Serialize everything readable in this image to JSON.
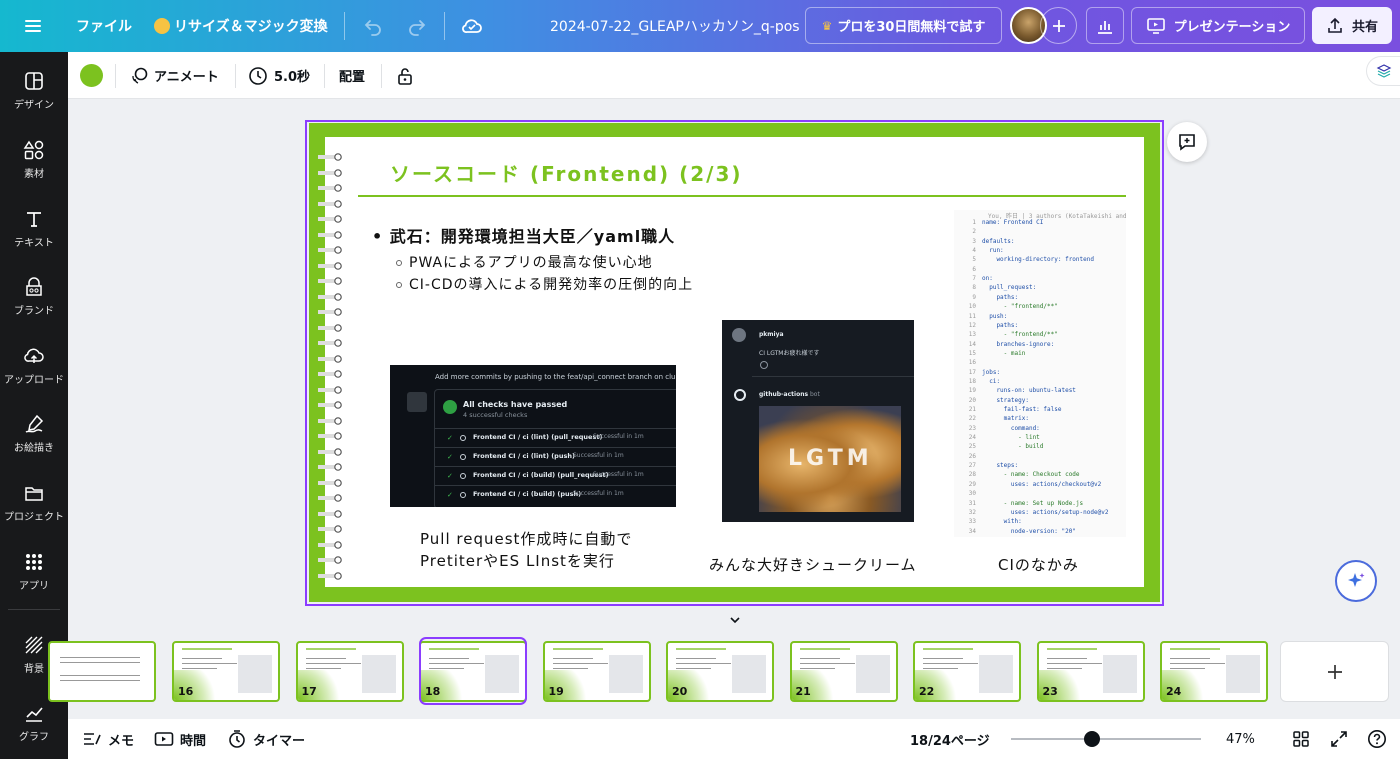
{
  "topbar": {
    "menu_icon": "hamburger-icon",
    "file_label": "ファイル",
    "resize_label": "リサイズ＆マジック変換",
    "doc_title": "2024-07-22_GLEAPハッカソン_q-pos",
    "pro_label": "プロを30日間無料で試す",
    "present_label": "プレゼンテーション",
    "share_label": "共有"
  },
  "sidebar": {
    "items": [
      {
        "label": "デザイン",
        "icon": "layout-icon"
      },
      {
        "label": "素材",
        "icon": "shapes-icon"
      },
      {
        "label": "テキスト",
        "icon": "text-icon"
      },
      {
        "label": "ブランド",
        "icon": "brand-icon"
      },
      {
        "label": "アップロード",
        "icon": "upload-icon"
      },
      {
        "label": "お絵描き",
        "icon": "draw-icon"
      },
      {
        "label": "プロジェクト",
        "icon": "folder-icon"
      },
      {
        "label": "アプリ",
        "icon": "apps-icon"
      },
      {
        "label": "背景",
        "icon": "background-icon"
      },
      {
        "label": "グラフ",
        "icon": "chart-icon"
      }
    ]
  },
  "toolbar": {
    "color": "#7cc21f",
    "animate_label": "アニメート",
    "duration_label": "5.0秒",
    "arrange_label": "配置"
  },
  "slide": {
    "title": "ソースコード (Frontend) (2/3)",
    "bullet": "• 武石：開発環境担当大臣／yaml職人",
    "sub1": "PWAによるアプリの最高な使い心地",
    "sub2": "CI-CDの導入による開発効率の圧倒的向上",
    "caption1_line1": "Pull request作成時に自動で",
    "caption1_line2": "PretiterやES LInstを実行",
    "caption2": "みんな大好きシュークリーム",
    "caption3": "CIのなかみ",
    "shot1": {
      "header": "Add more commits by pushing to the feat/api_connect branch on club-g",
      "status": "All checks have passed",
      "substatus": "4 successful checks",
      "checks": [
        {
          "name": "Frontend CI / ci (lint) (pull_request)",
          "result": "Successful in 1m"
        },
        {
          "name": "Frontend CI / ci (lint) (push)",
          "result": "Successful in 1m"
        },
        {
          "name": "Frontend CI / ci (build) (pull_request)",
          "result": "Successful in 1m"
        },
        {
          "name": "Frontend CI / ci (build) (push)",
          "result": "Successful in 1m"
        }
      ]
    },
    "shot2": {
      "user1": "pkmiya",
      "msg1": "CI LGTMお疲れ様です",
      "user2": "github-actions",
      "badge": "bot",
      "stamp": "LGTM"
    },
    "shot3": {
      "blame": "You, 昨日 | 3 authors (KotaTakeishi and one other)",
      "lines": [
        "name: Frontend CI",
        "",
        "defaults:",
        "  run:",
        "    working-directory: frontend",
        "",
        "on:",
        "  pull_request:",
        "    paths:",
        "      - \"frontend/**\"",
        "  push:",
        "    paths:",
        "      - \"frontend/**\"",
        "    branches-ignore:",
        "      - main",
        "",
        "jobs:",
        "  ci:",
        "    runs-on: ubuntu-latest",
        "    strategy:",
        "      fail-fast: false",
        "      matrix:",
        "        command:",
        "          - lint",
        "          - build",
        "",
        "    steps:",
        "      - name: Checkout code",
        "        uses: actions/checkout@v2",
        "",
        "      - name: Set up Node.js",
        "        uses: actions/setup-node@v2",
        "      with:",
        "        node-version: \"20\""
      ]
    }
  },
  "filmstrip": {
    "pages": [
      "16",
      "17",
      "18",
      "19",
      "20",
      "21",
      "22",
      "23",
      "24"
    ],
    "current": "18",
    "add_icon": "plus-icon"
  },
  "bottombar": {
    "notes_label": "メモ",
    "time_label": "時間",
    "timer_label": "タイマー",
    "page_indicator": "18/24ページ",
    "zoom_value": 47,
    "zoom_label": "47%"
  }
}
